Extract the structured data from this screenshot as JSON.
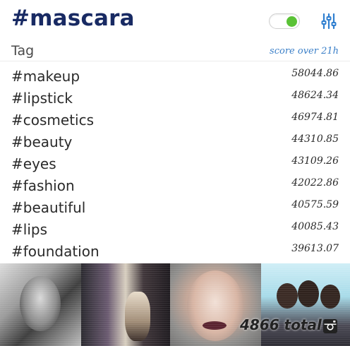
{
  "header": {
    "title": "#mascara",
    "toggle_on": true,
    "colors": {
      "title": "#182a63",
      "accent": "#3a7fc8",
      "toggle": "#5ac236"
    },
    "filter_icon": "sliders-icon"
  },
  "columns": {
    "tag_label": "Tag",
    "score_label": "score over 21h"
  },
  "rows": [
    {
      "tag": "#makeup",
      "score": "58044.86"
    },
    {
      "tag": "#lipstick",
      "score": "48624.34"
    },
    {
      "tag": "#cosmetics",
      "score": "46974.81"
    },
    {
      "tag": "#beauty",
      "score": "44310.85"
    },
    {
      "tag": "#eyes",
      "score": "43109.26"
    },
    {
      "tag": "#fashion",
      "score": "42022.86"
    },
    {
      "tag": "#beautiful",
      "score": "40575.59"
    },
    {
      "tag": "#lips",
      "score": "40085.43"
    },
    {
      "tag": "#foundation",
      "score": "39613.07"
    }
  ],
  "footer": {
    "total_label": "4866 total",
    "icon": "instagram-icon"
  }
}
